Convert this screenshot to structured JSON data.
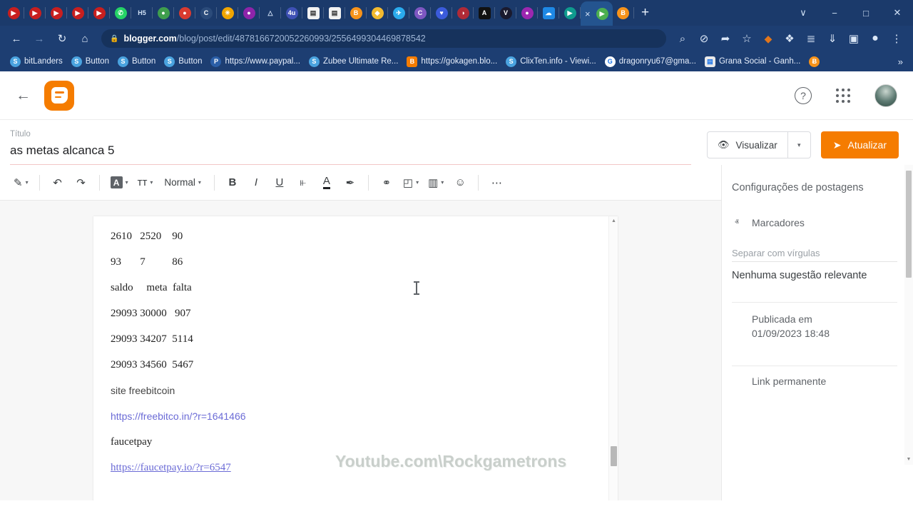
{
  "browser": {
    "tabs_pinned": [
      {
        "name": "youtube",
        "glyph": "▶",
        "bg": "#c81f1f",
        "shape": "round"
      },
      {
        "name": "youtube",
        "glyph": "▶",
        "bg": "#c81f1f",
        "shape": "round"
      },
      {
        "name": "youtube",
        "glyph": "▶",
        "bg": "#c81f1f",
        "shape": "round"
      },
      {
        "name": "youtube",
        "glyph": "▶",
        "bg": "#c81f1f",
        "shape": "round"
      },
      {
        "name": "youtube",
        "glyph": "▶",
        "bg": "#c81f1f",
        "shape": "round"
      },
      {
        "name": "whatsapp",
        "glyph": "✆",
        "bg": "#25d366",
        "shape": "round"
      },
      {
        "name": "h5",
        "glyph": "H5",
        "bg": "transparent",
        "shape": "round"
      },
      {
        "name": "globe",
        "glyph": "●",
        "bg": "#3f9e4d",
        "shape": "round"
      },
      {
        "name": "apple",
        "glyph": "●",
        "bg": "#d93b30",
        "shape": "round"
      },
      {
        "name": "coin-c",
        "glyph": "C",
        "bg": "#2b4b7a",
        "shape": "round"
      },
      {
        "name": "pinwheel",
        "glyph": "✳",
        "bg": "#f0a500",
        "shape": "round"
      },
      {
        "name": "pin-purple",
        "glyph": "●",
        "bg": "#8e24aa",
        "shape": "round"
      },
      {
        "name": "triangle",
        "glyph": "△",
        "bg": "transparent",
        "shape": "round"
      },
      {
        "name": "4u",
        "glyph": "4u",
        "bg": "#3f51b5",
        "shape": "round"
      },
      {
        "name": "sq-white-1",
        "glyph": "▤",
        "bg": "#f2f2f2",
        "shape": "sq"
      },
      {
        "name": "sq-white-2",
        "glyph": "▤",
        "bg": "#f2f2f2",
        "shape": "sq"
      },
      {
        "name": "bitcoin",
        "glyph": "B",
        "bg": "#f7931a",
        "shape": "round"
      },
      {
        "name": "binance",
        "glyph": "◆",
        "bg": "#f3ba2f",
        "shape": "round"
      },
      {
        "name": "telegram",
        "glyph": "✈",
        "bg": "#2aabee",
        "shape": "round"
      },
      {
        "name": "c-circle",
        "glyph": "C",
        "bg": "#7e57c2",
        "shape": "round"
      },
      {
        "name": "heart",
        "glyph": "♥",
        "bg": "#3b5bdb",
        "shape": "round"
      },
      {
        "name": "dark-split",
        "glyph": "◑",
        "bg": "#b02a37",
        "shape": "round"
      },
      {
        "name": "a-dark",
        "glyph": "A",
        "bg": "#111111",
        "shape": "sq"
      },
      {
        "name": "v-green",
        "glyph": "V",
        "bg": "#1a1a2e",
        "shape": "round"
      },
      {
        "name": "p-purple",
        "glyph": "●",
        "bg": "#9c27b0",
        "shape": "round"
      },
      {
        "name": "cloud-blue",
        "glyph": "☁",
        "bg": "#1e88e5",
        "shape": "sq"
      },
      {
        "name": "play-teal",
        "glyph": "▶",
        "bg": "#0f9b8e",
        "shape": "round"
      }
    ],
    "active_tab": {
      "close_label": "×",
      "favicon_glyph": "▶",
      "favicon_bg": "#4caf50"
    },
    "tabs_after": [
      {
        "name": "bitcoin",
        "glyph": "Ƀ",
        "bg": "#f7931a",
        "shape": "round"
      }
    ],
    "new_tab_label": "+",
    "window_controls": {
      "list": "∨",
      "minimize": "−",
      "maximize": "□",
      "close": "✕"
    },
    "nav": {
      "back": "←",
      "forward": "→",
      "reload": "↻",
      "home": "⌂",
      "lock_icon": "🔒",
      "url_domain": "blogger.com",
      "url_path": "/blog/post/edit/4878166720052260993/2556499304469878542"
    },
    "toolbar_right": [
      {
        "name": "zoom-icon",
        "glyph": "⌕"
      },
      {
        "name": "eye-slash-icon",
        "glyph": "⊘"
      },
      {
        "name": "share-icon",
        "glyph": "➦"
      },
      {
        "name": "star-icon",
        "glyph": "☆"
      },
      {
        "name": "metamask-fox-icon",
        "glyph": "◆"
      },
      {
        "name": "extensions-puzzle-icon",
        "glyph": "❖"
      },
      {
        "name": "reading-list-icon",
        "glyph": "≣"
      },
      {
        "name": "downloads-icon",
        "glyph": "⇓"
      },
      {
        "name": "side-panel-icon",
        "glyph": "▣"
      },
      {
        "name": "profile-avatar-icon",
        "glyph": "●"
      },
      {
        "name": "chrome-menu-icon",
        "glyph": "⋮"
      }
    ],
    "bookmarks": [
      {
        "label": "bitLanders",
        "icon_glyph": "S",
        "icon_bg": "#4aa3df",
        "shape": "round"
      },
      {
        "label": "Button",
        "icon_glyph": "S",
        "icon_bg": "#4aa3df",
        "shape": "round"
      },
      {
        "label": "Button",
        "icon_glyph": "S",
        "icon_bg": "#4aa3df",
        "shape": "round"
      },
      {
        "label": "Button",
        "icon_glyph": "S",
        "icon_bg": "#4aa3df",
        "shape": "round"
      },
      {
        "label": "https://www.paypal...",
        "icon_glyph": "P",
        "icon_bg": "#2b5fa8",
        "shape": "round"
      },
      {
        "label": "Zubee Ultimate Re...",
        "icon_glyph": "S",
        "icon_bg": "#4aa3df",
        "shape": "round"
      },
      {
        "label": "https://gokagen.blo...",
        "icon_glyph": "B",
        "icon_bg": "#f57c00",
        "shape": "sq"
      },
      {
        "label": "ClixTen.info - Viewi...",
        "icon_glyph": "S",
        "icon_bg": "#4aa3df",
        "shape": "round"
      },
      {
        "label": "dragonryu67@gma...",
        "icon_glyph": "G",
        "icon_bg": "#ffffff",
        "shape": "round"
      },
      {
        "label": "Grana Social - Ganh...",
        "icon_glyph": "▤",
        "icon_bg": "#eaeaea",
        "shape": "sq"
      },
      {
        "label": "",
        "icon_glyph": "Ƀ",
        "icon_bg": "#f7931a",
        "shape": "round"
      }
    ],
    "bookmarks_overflow": "»"
  },
  "blogger": {
    "back_label": "←",
    "help_label": "?",
    "title_label": "Título",
    "title_value": "as metas alcanca 5",
    "preview_button": "Visualizar",
    "preview_caret": "▾",
    "update_button": "Atualizar",
    "send_icon": "➤",
    "eye_icon": "👁",
    "toolbar": [
      {
        "name": "pen-tool",
        "glyph": "✎",
        "caret": true
      },
      {
        "name": "sep"
      },
      {
        "name": "undo",
        "glyph": "↶",
        "caret": false
      },
      {
        "name": "redo",
        "glyph": "↷",
        "caret": false
      },
      {
        "name": "sep"
      },
      {
        "name": "font-family",
        "glyph": "A",
        "caret": true,
        "boxed": true
      },
      {
        "name": "font-size",
        "glyph": "ᴛᴛ",
        "caret": true
      },
      {
        "name": "paragraph-style",
        "label": "Normal",
        "caret": true
      },
      {
        "name": "sep"
      },
      {
        "name": "bold",
        "glyph": "B",
        "caret": false
      },
      {
        "name": "italic",
        "glyph": "I",
        "caret": false
      },
      {
        "name": "underline",
        "glyph": "U",
        "caret": false
      },
      {
        "name": "strikethrough",
        "glyph": "⫦",
        "caret": false
      },
      {
        "name": "text-color",
        "glyph": "A",
        "caret": false,
        "underbar": true
      },
      {
        "name": "highlight-color",
        "glyph": "✒",
        "caret": false
      },
      {
        "name": "sep"
      },
      {
        "name": "insert-link",
        "glyph": "⚭",
        "caret": false
      },
      {
        "name": "insert-image",
        "glyph": "◰",
        "caret": true
      },
      {
        "name": "insert-video",
        "glyph": "▥",
        "caret": true
      },
      {
        "name": "insert-emoji",
        "glyph": "☺",
        "caret": false
      },
      {
        "name": "sep"
      },
      {
        "name": "more-options",
        "glyph": "⋯",
        "caret": false
      }
    ],
    "document_lines": [
      {
        "text": "2610   2520    90",
        "style": "serif"
      },
      {
        "text": "93       7          86",
        "style": "serif"
      },
      {
        "text": "saldo     meta  falta",
        "style": "serif"
      },
      {
        "text": "29093 30000   907",
        "style": "serif"
      },
      {
        "text": "29093 34207  5114",
        "style": "serif"
      },
      {
        "text": "29093 34560  5467",
        "style": "serif"
      },
      {
        "text": "site freebitcoin",
        "style": "sans"
      },
      {
        "text": "https://freebitco.in/?r=1641466",
        "style": "sans-link"
      },
      {
        "text": "faucetpay",
        "style": "serif"
      },
      {
        "text": "https://faucetpay.io/?r=6547",
        "style": "serif-link"
      }
    ],
    "watermark": "Youtube.com\\Rockgametrons",
    "sidebar": {
      "title": "Configurações de postagens",
      "labels_section": {
        "chevron": "ⱏ",
        "label": "Marcadores"
      },
      "labels_placeholder": "Separar com vírgulas",
      "labels_suggestion": "Nenhuma sugestão relevante",
      "published_section": {
        "chevron": "ⱟ",
        "label": "Publicada em",
        "value": "01/09/2023 18:48"
      },
      "permalink_section": {
        "chevron": "ⱟ",
        "label": "Link permanente"
      }
    }
  },
  "colors": {
    "brand_orange": "#f57c00",
    "chrome_blue": "#1d3e72",
    "link_purple": "#6b6bd6"
  }
}
